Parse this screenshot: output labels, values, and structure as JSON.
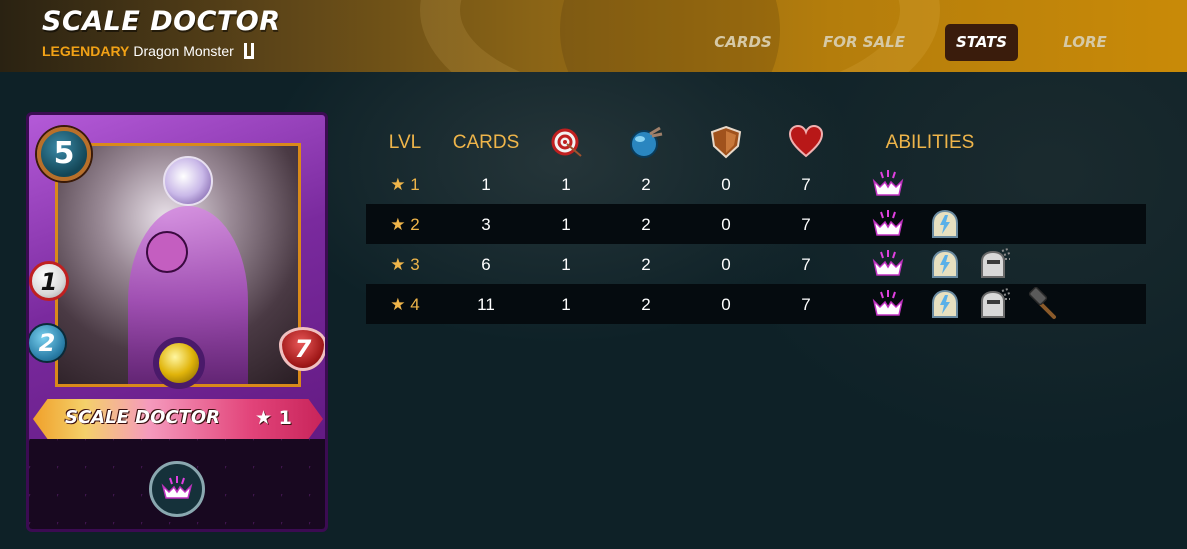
{
  "header": {
    "title": "SCALE DOCTOR",
    "rarity": "LEGENDARY",
    "description": "Dragon Monster",
    "tabs": [
      {
        "label": "CARDS",
        "active": false
      },
      {
        "label": "FOR SALE",
        "active": false
      },
      {
        "label": "STATS",
        "active": true
      },
      {
        "label": "LORE",
        "active": false
      }
    ]
  },
  "card": {
    "name": "SCALE DOCTOR",
    "level_label": "★ 1",
    "mana": "5",
    "attack": "1",
    "speed": "2",
    "health": "7",
    "ability_icon": "rejuvenate-icon"
  },
  "stats_table": {
    "headers": {
      "level": "LVL",
      "cards": "CARDS",
      "ranged_icon": "ranged-attack-icon",
      "speed_icon": "speed-icon",
      "armor_icon": "armor-icon",
      "health_icon": "health-icon",
      "abilities": "ABILITIES"
    },
    "rows": [
      {
        "level": "★ 1",
        "cards": "1",
        "ranged": "1",
        "speed": "2",
        "armor": "0",
        "health": "7",
        "abilities": [
          "rejuvenate-icon"
        ]
      },
      {
        "level": "★ 2",
        "cards": "3",
        "ranged": "1",
        "speed": "2",
        "armor": "0",
        "health": "7",
        "abilities": [
          "rejuvenate-icon",
          "shield-ward-icon"
        ]
      },
      {
        "level": "★ 3",
        "cards": "6",
        "ranged": "1",
        "speed": "2",
        "armor": "0",
        "health": "7",
        "abilities": [
          "rejuvenate-icon",
          "shield-ward-icon",
          "repair-icon"
        ]
      },
      {
        "level": "★ 4",
        "cards": "11",
        "ranged": "1",
        "speed": "2",
        "armor": "0",
        "health": "7",
        "abilities": [
          "rejuvenate-icon",
          "shield-ward-icon",
          "repair-icon",
          "hammer-icon"
        ]
      }
    ]
  },
  "colors": {
    "accent_gold": "#efb54a",
    "rarity_orange": "#f2a216",
    "row_alt": "#050b0f",
    "background": "#0e2127"
  }
}
